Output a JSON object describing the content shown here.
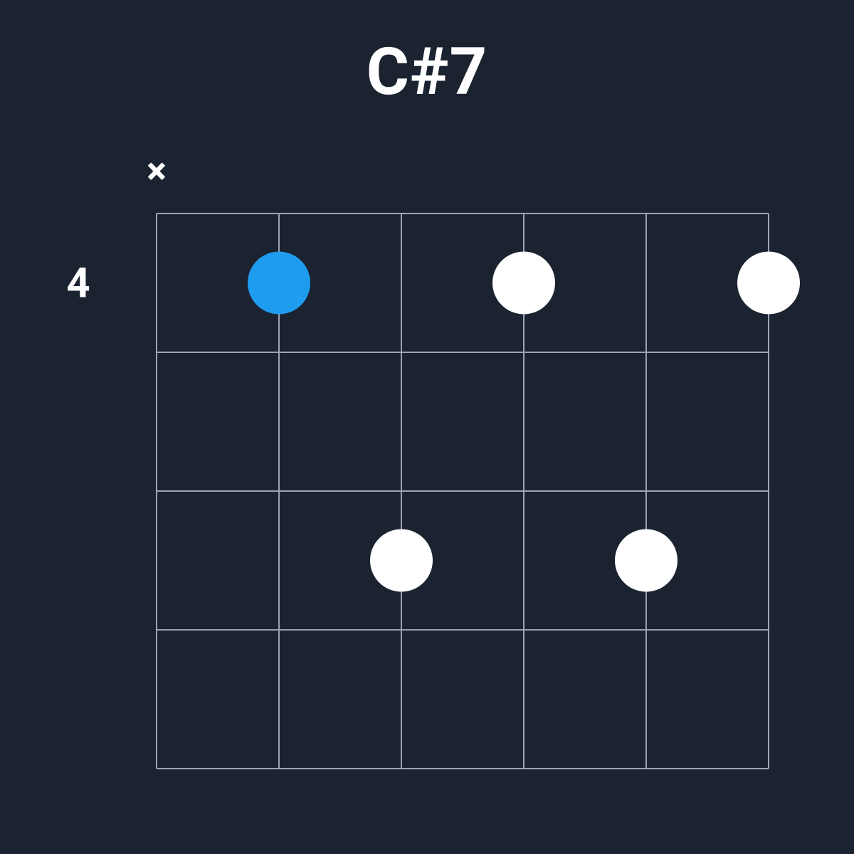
{
  "chord": {
    "name": "C#7",
    "baseFret": 4,
    "numFrets": 4,
    "numStrings": 6,
    "stringStates": [
      "muted",
      "none",
      "none",
      "none",
      "none",
      "none"
    ],
    "fingers": [
      {
        "string": 2,
        "fret": 1,
        "root": true
      },
      {
        "string": 3,
        "fret": 3,
        "root": false
      },
      {
        "string": 4,
        "fret": 1,
        "root": false
      },
      {
        "string": 5,
        "fret": 3,
        "root": false
      },
      {
        "string": 6,
        "fret": 1,
        "root": false
      }
    ]
  },
  "symbols": {
    "muted": "×",
    "open": "○"
  },
  "colors": {
    "bg": "#1b2331",
    "grid": "#9aa4b2",
    "dot": "#ffffff",
    "root": "#1e9cf0",
    "text": "#ffffff"
  },
  "layout": {
    "gridLeft": 220,
    "gridTop": 300,
    "gridWidth": 860,
    "gridHeight": 780,
    "dotRadius": 44,
    "headerGap": 60
  }
}
